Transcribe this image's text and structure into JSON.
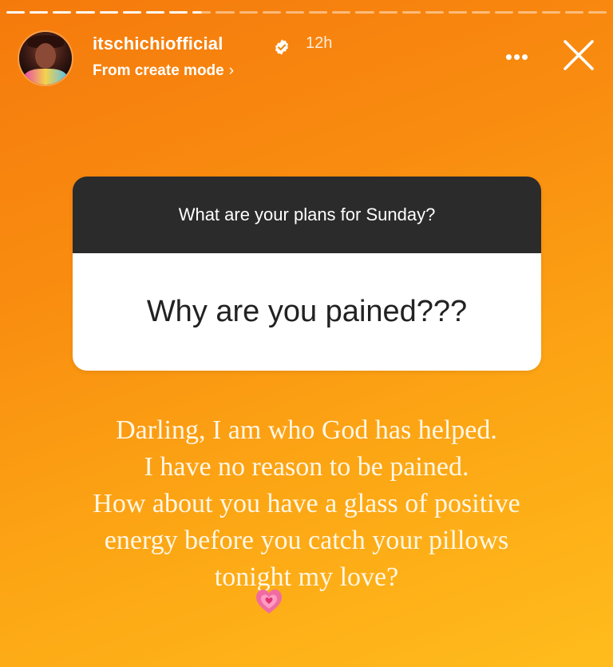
{
  "story": {
    "progress_segments": [
      "done",
      "done",
      "done",
      "done",
      "done",
      "done",
      "done",
      "done",
      "partial",
      "upcoming",
      "upcoming",
      "upcoming",
      "upcoming",
      "upcoming",
      "upcoming",
      "upcoming",
      "upcoming",
      "upcoming",
      "upcoming",
      "upcoming",
      "upcoming",
      "upcoming",
      "upcoming",
      "upcoming",
      "upcoming",
      "upcoming"
    ],
    "background_colors": [
      "#f57a0c",
      "#ffbc1c"
    ]
  },
  "header": {
    "username": "itschichiofficial",
    "verified_icon": "verified-badge-icon",
    "time_ago": "12h",
    "subtitle": "From create mode",
    "subtitle_chevron": "›",
    "more_label": "•••",
    "close_icon": "close-icon"
  },
  "question_sticker": {
    "prompt": "What are your plans for Sunday?",
    "answer": "Why are you pained???"
  },
  "reply_text": {
    "lines": [
      "Darling, I am who God has helped.",
      "I have no reason to be pained.",
      "How about you have a glass of positive",
      "energy before you catch your pillows",
      "tonight my love?"
    ],
    "emoji": "growing-heart-icon"
  }
}
